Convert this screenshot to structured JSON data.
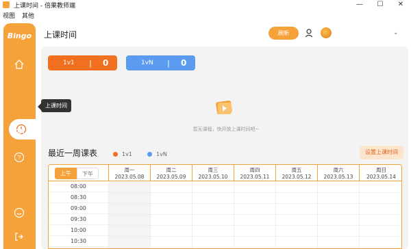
{
  "window": {
    "title": "上课时间 - 倍果教师端",
    "controls": [
      "—",
      "☐",
      "✕"
    ]
  },
  "menu": [
    "视图",
    "其他"
  ],
  "sidebar": {
    "brand": "Bingo",
    "items": [
      {
        "name": "home",
        "icon": "home-icon"
      },
      {
        "name": "schedule",
        "icon": "clock-icon",
        "active": true
      },
      {
        "name": "profile",
        "icon": "user-icon"
      },
      {
        "name": "help",
        "icon": "help-icon"
      },
      {
        "name": "chat",
        "icon": "chat-icon"
      },
      {
        "name": "logout",
        "icon": "logout-icon"
      }
    ],
    "tooltip": "上课时间"
  },
  "header": {
    "title": "上课时间",
    "refresh": "刷新"
  },
  "stats": [
    {
      "label": "1v1",
      "sep": "|",
      "value": "0",
      "color": "#f07020"
    },
    {
      "label": "1vN",
      "sep": "|",
      "value": "0",
      "color": "#5b9cf0"
    }
  ],
  "empty": {
    "text": "暂无课程，快开放上课时间吧~"
  },
  "week": {
    "title": "最近一周课表",
    "legend": [
      {
        "label": "1v1",
        "color": "#f07020"
      },
      {
        "label": "1vN",
        "color": "#5b9cf0"
      }
    ],
    "set_button": "设置上课时间",
    "am": "上午",
    "pm": "下午",
    "days": [
      {
        "name": "周一",
        "date": "2023.05.08"
      },
      {
        "name": "周二",
        "date": "2023.05.09"
      },
      {
        "name": "周三",
        "date": "2023.05.10"
      },
      {
        "name": "周四",
        "date": "2023.05.11"
      },
      {
        "name": "周五",
        "date": "2023.05.12"
      },
      {
        "name": "周六",
        "date": "2023.05.13"
      },
      {
        "name": "周日",
        "date": "2023.05.14"
      }
    ],
    "times": [
      "08:00",
      "08:30",
      "09:00",
      "09:30",
      "10:00",
      "10:30"
    ]
  }
}
